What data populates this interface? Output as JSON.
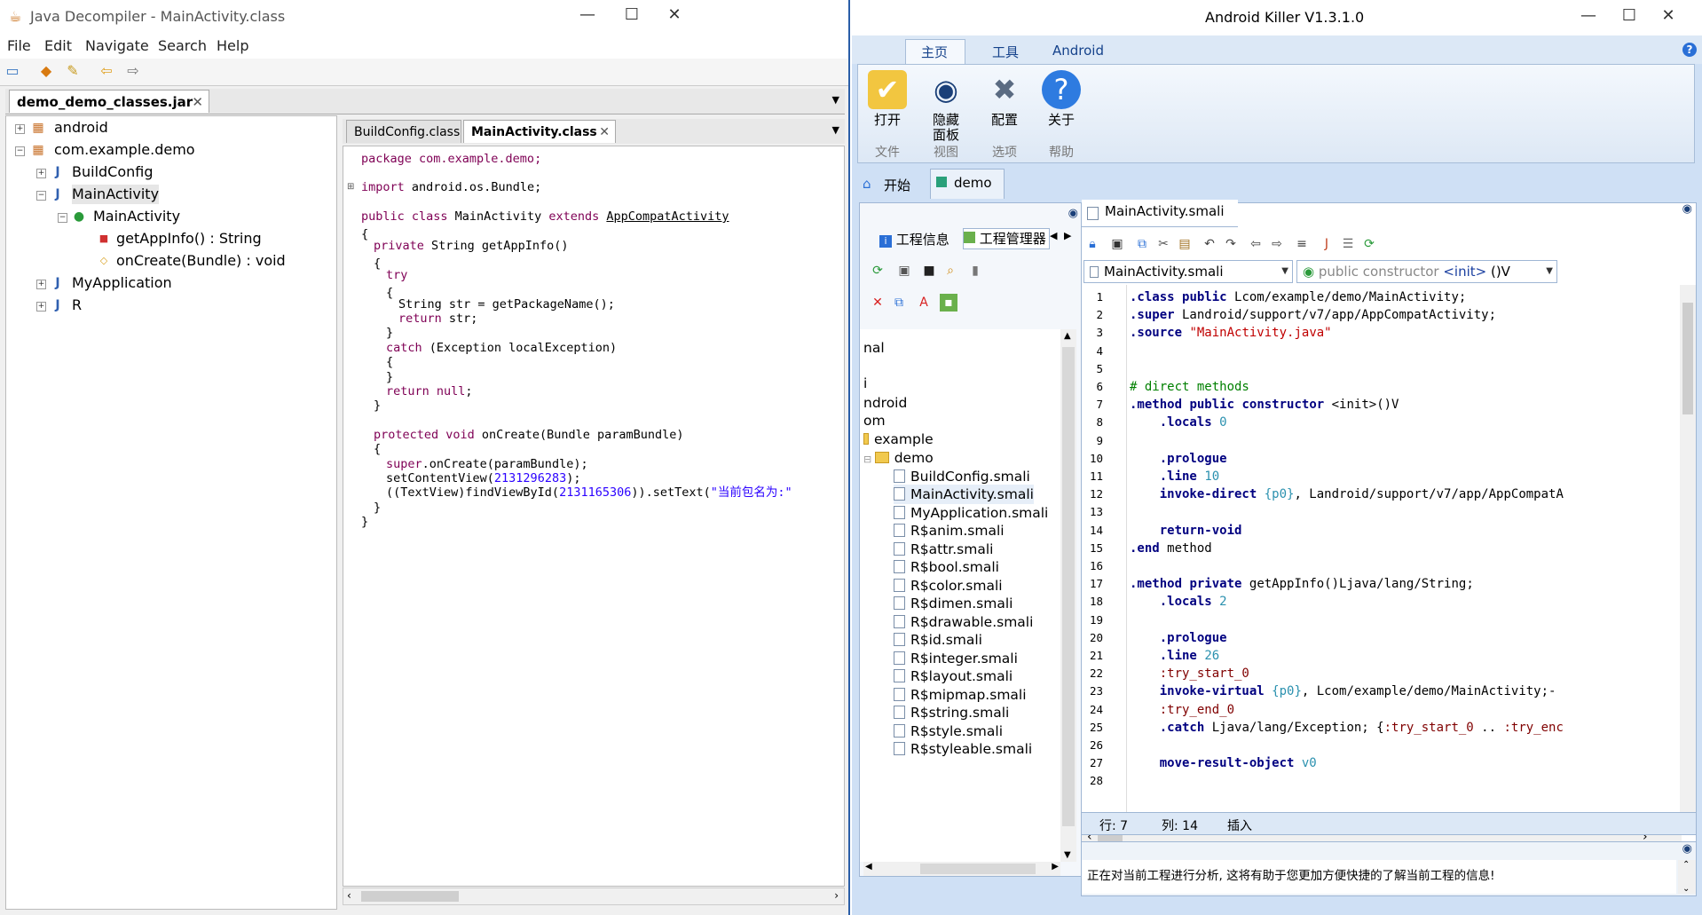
{
  "jd": {
    "title": "Java Decompiler - MainActivity.class",
    "menu": [
      "File",
      "Edit",
      "Navigate",
      "Search",
      "Help"
    ],
    "jar_tab": "demo_demo_classes.jar",
    "tree": {
      "android": "android",
      "package": "com.example.demo",
      "buildconfig": "BuildConfig",
      "mainactivity": "MainActivity",
      "mainactivity_class": "MainActivity",
      "method1": "getAppInfo() : String",
      "method2": "onCreate(Bundle) : void",
      "myapplication": "MyApplication",
      "r": "R"
    },
    "code_tabs": [
      "BuildConfig.class",
      "MainActivity.class"
    ],
    "code": {
      "l1": "package com.example.demo;",
      "l2_kw": "import",
      "l2": " android.os.Bundle;",
      "l3_a": "public class",
      "l3_b": " MainActivity ",
      "l3_c": "extends",
      "l3_d": "AppCompatActivity",
      "l4": "{",
      "l5_kw": "private",
      "l5": " String getAppInfo()",
      "l6": "{",
      "l7": "try",
      "l8": "{",
      "l9": "String str = getPackageName();",
      "l10_kw": "return",
      "l10": " str;",
      "l11": "}",
      "l12_kw": "catch",
      "l12": " (Exception localException)",
      "l13": "{",
      "l14": "}",
      "l15_kw": "return null",
      "l15": ";",
      "l16": "}",
      "l17_kw": "protected void",
      "l17": " onCreate(Bundle paramBundle)",
      "l18": "{",
      "l19_kw": "super",
      "l19": ".onCreate(paramBundle);",
      "l20_a": "setContentView(",
      "l20_n": "2131296283",
      "l20_b": ");",
      "l21_a": "((TextView)findViewById(",
      "l21_n": "2131165306",
      "l21_b": ")).setText(",
      "l21_s": "\"当前包名为:\"",
      "l22": "}",
      "l23": "}"
    }
  },
  "ak": {
    "title": "Android Killer V1.3.1.0",
    "ribbon_tabs": [
      "主页",
      "工具",
      "Android"
    ],
    "ribbon_buttons": [
      {
        "label": "打开",
        "group": "文件",
        "icon": "open-folder-icon"
      },
      {
        "label": "隐藏面板",
        "group": "视图",
        "icon": "eye-icon"
      },
      {
        "label": "配置",
        "group": "选项",
        "icon": "tools-icon"
      },
      {
        "label": "关于",
        "group": "帮助",
        "icon": "help-icon"
      }
    ],
    "doc_tabs": [
      "开始",
      "demo"
    ],
    "left_tabs": [
      "工程信息",
      "工程管理器"
    ],
    "left_tree": [
      "nal",
      "i",
      "ndroid",
      "om",
      "example",
      "demo",
      "BuildConfig.smali",
      "MainActivity.smali",
      "MyApplication.smali",
      "R$anim.smali",
      "R$attr.smali",
      "R$bool.smali",
      "R$color.smali",
      "R$dimen.smali",
      "R$drawable.smali",
      "R$id.smali",
      "R$integer.smali",
      "R$layout.smali",
      "R$mipmap.smali",
      "R$string.smali",
      "R$style.smali",
      "R$styleable.smali"
    ],
    "editor_tab": "MainActivity.smali",
    "class_combo": "MainActivity.smali",
    "method_combo_a": "public constructor ",
    "method_combo_b": "<init>",
    "method_combo_c": " ()V",
    "status": {
      "line": "行: 7",
      "col": "列: 14",
      "mode": "插入"
    },
    "bottom_msg": "正在对当前工程进行分析, 这将有助于您更加方便快捷的了解当前工程的信息!",
    "smali_lines": [
      ".class public Lcom/example/demo/MainActivity;",
      ".super Landroid/support/v7/app/AppCompatActivity;",
      ".source \"MainActivity.java\"",
      "",
      "",
      "# direct methods",
      ".method public constructor <init>()V",
      "    .locals 0",
      "",
      "    .prologue",
      "    .line 10",
      "    invoke-direct {p0}, Landroid/support/v7/app/AppCompatA",
      "",
      "    return-void",
      ".end method",
      "",
      ".method private getAppInfo()Ljava/lang/String;",
      "    .locals 2",
      "",
      "    .prologue",
      "    .line 26",
      "    :try_start_0",
      "    invoke-virtual {p0}, Lcom/example/demo/MainActivity;-",
      "    :try_end_0",
      "    .catch Ljava/lang/Exception; {:try_start_0 .. :try_enc",
      "",
      "    move-result-object v0",
      ""
    ],
    "line_numbers": [
      "1",
      "2",
      "3",
      "4",
      "5",
      "6",
      "7",
      "8",
      "9",
      "10",
      "11",
      "12",
      "13",
      "14",
      "15",
      "16",
      "17",
      "18",
      "19",
      "20",
      "21",
      "22",
      "23",
      "24",
      "25",
      "26",
      "27",
      "28"
    ]
  }
}
